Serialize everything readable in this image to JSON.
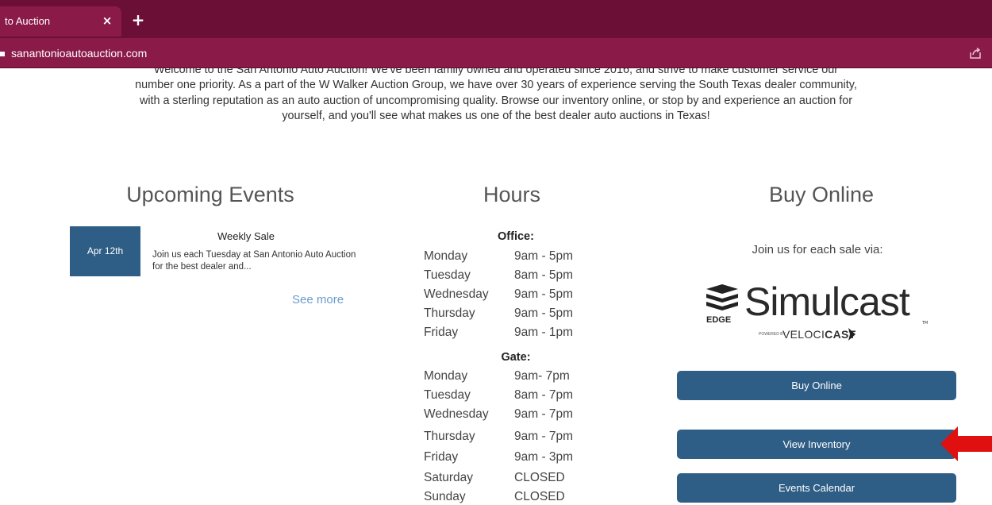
{
  "browser": {
    "tab_title": "to Auction",
    "tab_close": "×",
    "new_tab": "+",
    "url": "sanantonioautoauction.com"
  },
  "intro": {
    "text": "Welcome to the San Antonio Auto Auction! We've been family owned and operated since 2016, and strive to make customer service our number one priority. As a part of the W Walker Auction Group, we have over 30 years of experience serving the South Texas dealer community, with a sterling reputation as an auto auction of uncompromising quality. Browse our inventory online, or stop by and experience an auction for yourself, and you'll see what makes us one of the best dealer auto auctions in Texas!"
  },
  "events": {
    "heading": "Upcoming Events",
    "items": [
      {
        "date": "Apr 12th",
        "title": "Weekly Sale",
        "description": "Join us each Tuesday at San Antonio Auto Auction for the best dealer and..."
      }
    ],
    "see_more": "See more"
  },
  "hours": {
    "heading": "Hours",
    "office_label": "Office:",
    "office": [
      {
        "day": "Monday",
        "time": "9am - 5pm"
      },
      {
        "day": "Tuesday",
        "time": "8am - 5pm"
      },
      {
        "day": "Wednesday",
        "time": "9am - 5pm"
      },
      {
        "day": "Thursday",
        "time": "9am - 5pm"
      },
      {
        "day": "Friday",
        "time": "9am - 1pm"
      }
    ],
    "gate_label": "Gate:",
    "gate": [
      {
        "day": "Monday",
        "time": "9am- 7pm"
      },
      {
        "day": "Tuesday",
        "time": "8am - 7pm"
      },
      {
        "day": "Wednesday",
        "time": "9am - 7pm"
      },
      {
        "day": "Thursday",
        "time": "9am - 7pm"
      },
      {
        "day": "Friday",
        "time": "9am - 3pm"
      },
      {
        "day": "Saturday",
        "time": "CLOSED"
      },
      {
        "day": "Sunday",
        "time": "CLOSED"
      }
    ]
  },
  "buy_online": {
    "heading": "Buy Online",
    "join_text": "Join us for each sale via:",
    "logo": {
      "main": "Simulcast",
      "edge": "EDGE",
      "tm": "TM",
      "powered_by": "POWERED BY",
      "velo": "VELOCI",
      "cast": "CAST"
    },
    "buttons": {
      "buy_online": "Buy Online",
      "view_inventory": "View Inventory",
      "events_calendar": "Events Calendar"
    }
  },
  "colors": {
    "chrome": "#6b0f36",
    "chrome_light": "#8a1a48",
    "button": "#2e5d85",
    "link": "#6a9ccc",
    "annotation_arrow": "#e01010"
  }
}
